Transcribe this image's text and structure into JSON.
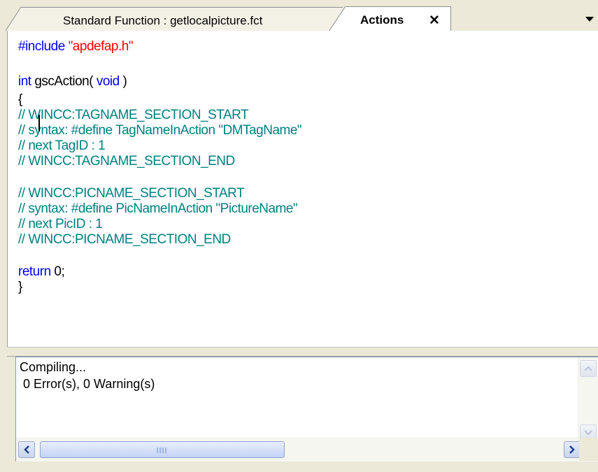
{
  "tabs": {
    "standard_label": "Standard Function : getlocalpicture.fct",
    "actions_label": "Actions",
    "close_glyph": "✕"
  },
  "editor": {
    "lines": [
      {
        "parts": [
          {
            "t": "#include ",
            "c": "kw"
          },
          {
            "t": "\"apdefap.h\"",
            "c": "str"
          }
        ]
      },
      {
        "parts": []
      },
      {
        "parts": [
          {
            "t": "int ",
            "c": "kw"
          },
          {
            "t": "gscAction( ",
            "c": "plain"
          },
          {
            "t": "void",
            "c": "kw"
          },
          {
            "t": " )",
            "c": "plain"
          }
        ]
      },
      {
        "parts": [
          {
            "t": "{",
            "c": "plain"
          }
        ]
      },
      {
        "parts": [
          {
            "t": "// WINCC:TAGNAME_SECTION_START",
            "c": "cmt"
          }
        ]
      },
      {
        "parts": [
          {
            "t": "// syntax: #define TagNameInAction \"DMTagName\"",
            "c": "cmt"
          }
        ]
      },
      {
        "parts": [
          {
            "t": "// next TagID : 1",
            "c": "cmt"
          }
        ]
      },
      {
        "parts": [
          {
            "t": "// WINCC:TAGNAME_SECTION_END",
            "c": "cmt"
          }
        ]
      },
      {
        "parts": []
      },
      {
        "parts": [
          {
            "t": "// WINCC:PICNAME_SECTION_START",
            "c": "cmt"
          }
        ]
      },
      {
        "parts": [
          {
            "t": "// syntax: #define PicNameInAction \"PictureName\"",
            "c": "cmt"
          }
        ]
      },
      {
        "parts": [
          {
            "t": "// next PicID : 1",
            "c": "cmt"
          }
        ]
      },
      {
        "parts": [
          {
            "t": "// WINCC:PICNAME_SECTION_END",
            "c": "cmt"
          }
        ]
      },
      {
        "parts": []
      },
      {
        "parts": [
          {
            "t": "return ",
            "c": "kw"
          },
          {
            "t": "0;",
            "c": "plain"
          }
        ]
      },
      {
        "parts": [
          {
            "t": "}",
            "c": "plain"
          }
        ]
      }
    ]
  },
  "output": {
    "line1": "Compiling...",
    "line2": " 0 Error(s), 0 Warning(s)"
  },
  "colors": {
    "keyword": "#0000ff",
    "string": "#ff0000",
    "comment": "#008080"
  },
  "icons": {
    "tab_menu": "chevron-down-icon",
    "scroll_up": "arrow-up-icon",
    "scroll_down": "arrow-down-icon",
    "scroll_left": "arrow-left-icon",
    "scroll_right": "arrow-right-icon"
  }
}
